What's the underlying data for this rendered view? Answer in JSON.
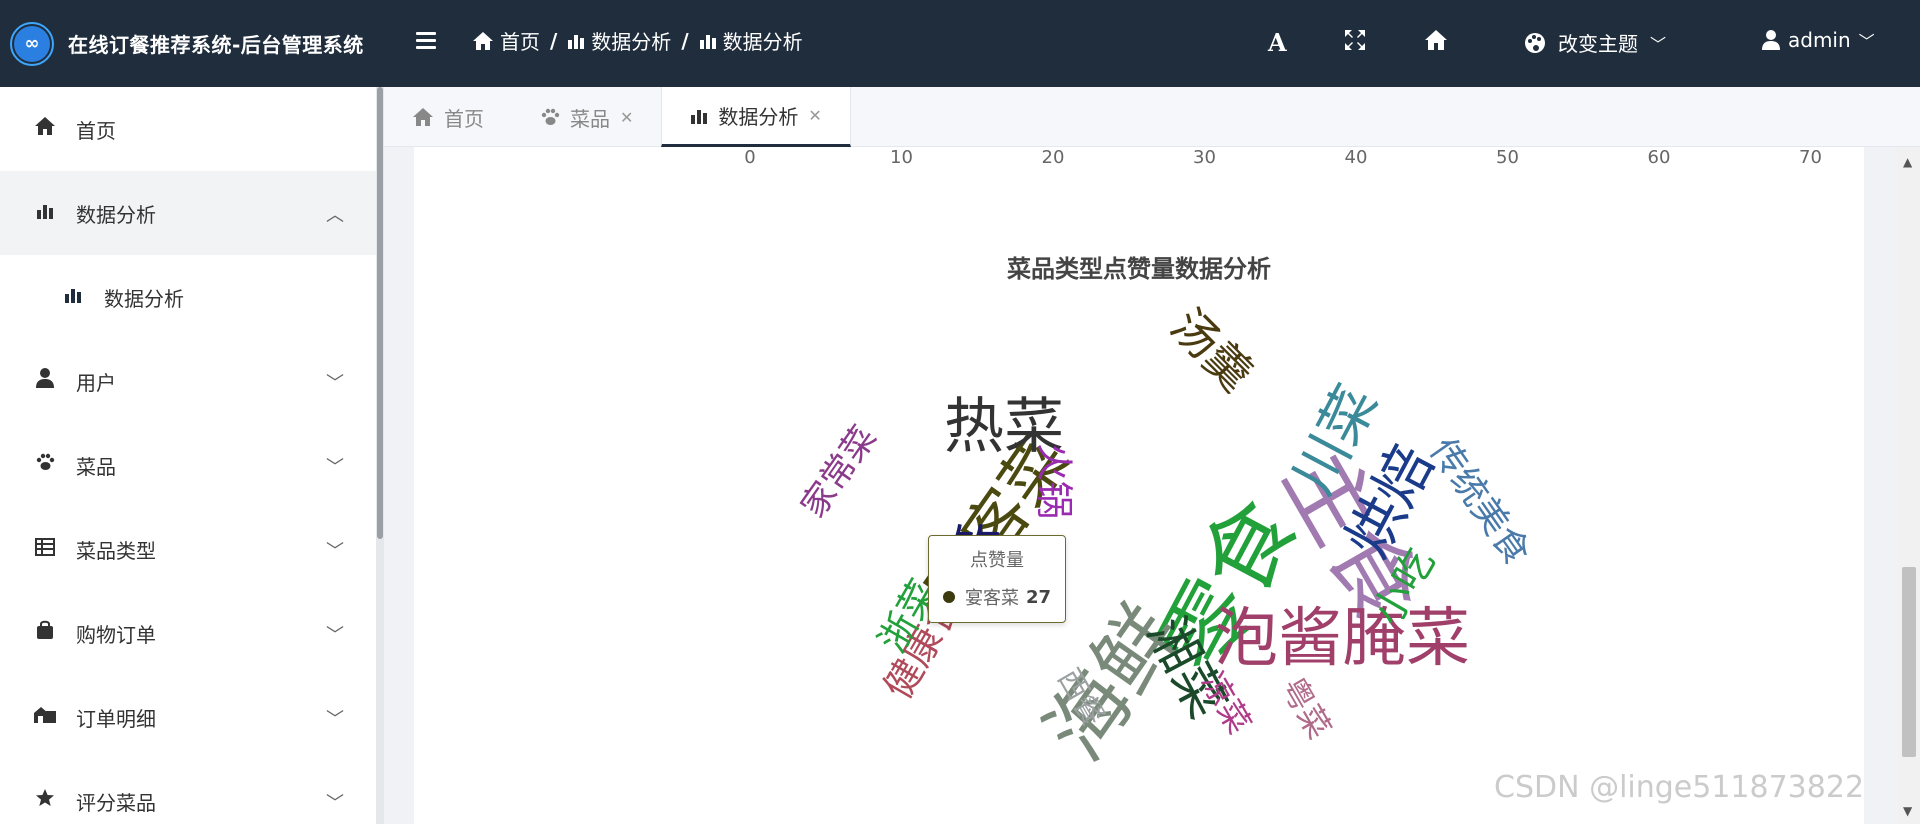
{
  "header": {
    "title": "在线订餐推荐系统-后台管理系统",
    "logo_text": "∞",
    "breadcrumb": [
      "首页",
      "数据分析",
      "数据分析"
    ],
    "theme_label": "改变主题",
    "user_name": "admin"
  },
  "sidebar": {
    "items": [
      {
        "label": "首页",
        "icon": "home-icon"
      },
      {
        "label": "数据分析",
        "icon": "bar-chart-icon",
        "expanded": true
      },
      {
        "label": "数据分析",
        "icon": "bar-chart-icon",
        "sub": true
      },
      {
        "label": "用户",
        "icon": "user-icon"
      },
      {
        "label": "菜品",
        "icon": "paw-icon"
      },
      {
        "label": "菜品类型",
        "icon": "table-icon"
      },
      {
        "label": "购物订单",
        "icon": "bag-icon"
      },
      {
        "label": "订单明细",
        "icon": "house-icon"
      },
      {
        "label": "评分菜品",
        "icon": "star-icon"
      }
    ]
  },
  "tabs": [
    {
      "label": "首页",
      "closable": false
    },
    {
      "label": "菜品",
      "closable": true
    },
    {
      "label": "数据分析",
      "closable": true,
      "active": true
    }
  ],
  "axis_ticks": [
    "0",
    "10",
    "20",
    "30",
    "40",
    "50",
    "60",
    "70"
  ],
  "chart_data": {
    "type": "wordcloud",
    "title": "菜品类型点赞量数据分析",
    "words": [
      {
        "text": "零食",
        "color": "#22a03a"
      },
      {
        "text": "主食",
        "color": "#a07ab0"
      },
      {
        "text": "海鲜",
        "color": "#7a8a7a"
      },
      {
        "text": "宴客菜",
        "color": "#4a4a10",
        "value": 27
      },
      {
        "text": "泡酱腌菜",
        "color": "#a0406a"
      },
      {
        "text": "热菜",
        "color": "#333333"
      },
      {
        "text": "湘菜",
        "color": "#1a4a2a"
      },
      {
        "text": "烘焙",
        "color": "#1a3a8a"
      },
      {
        "text": "川菜",
        "color": "#3a8a9a"
      },
      {
        "text": "汤羹",
        "color": "#4a3a10"
      },
      {
        "text": "传统美食",
        "color": "#4a7aaa"
      },
      {
        "text": "家常菜",
        "color": "#8a3a8a"
      },
      {
        "text": "火锅",
        "color": "#9a2ab0"
      },
      {
        "text": "小吃",
        "color": "#22a03a"
      },
      {
        "text": "健康食",
        "color": "#b04a5a"
      },
      {
        "text": "浙菜",
        "color": "#22a03a"
      },
      {
        "text": "西餐",
        "color": "#9aa0a0"
      },
      {
        "text": "凉菜",
        "color": "#b03a8a"
      },
      {
        "text": "粤菜",
        "color": "#b06a8a"
      },
      {
        "text": "饮",
        "color": "#1a1a6a"
      }
    ]
  },
  "tooltip": {
    "title": "点赞量",
    "name": "宴客菜",
    "value": "27"
  },
  "watermark": "CSDN @linge511873822"
}
